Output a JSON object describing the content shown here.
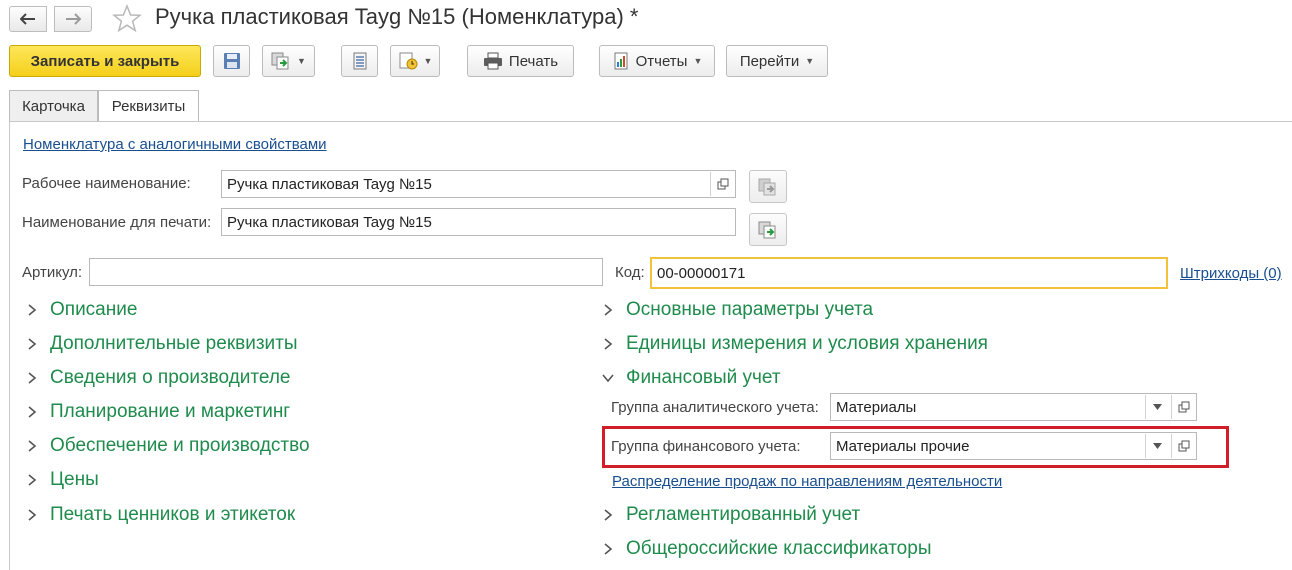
{
  "header": {
    "title": "Ручка пластиковая Tayg №15 (Номенклатура) *"
  },
  "toolbar": {
    "save_close": "Записать и закрыть",
    "print": "Печать",
    "reports": "Отчеты",
    "goto": "Перейти"
  },
  "tabs": [
    {
      "label": "Карточка"
    },
    {
      "label": "Реквизиты"
    }
  ],
  "form": {
    "similar_link": "Номенклатура с аналогичными свойствами",
    "work_name_label": "Рабочее наименование:",
    "work_name_value": "Ручка пластиковая Tayg №15",
    "print_name_label": "Наименование для печати:",
    "print_name_value": "Ручка пластиковая Tayg №15",
    "article_label": "Артикул:",
    "article_value": "",
    "code_label": "Код:",
    "code_value": "00-00000171",
    "barcodes_link": "Штрихкоды (0)"
  },
  "left_groups": [
    {
      "label": "Описание"
    },
    {
      "label": "Дополнительные реквизиты"
    },
    {
      "label": "Сведения о производителе"
    },
    {
      "label": "Планирование и маркетинг"
    },
    {
      "label": "Обеспечение и производство"
    },
    {
      "label": "Цены"
    },
    {
      "label": "Печать ценников и этикеток"
    }
  ],
  "right_groups": {
    "main_params": "Основные параметры учета",
    "units": "Единицы измерения и условия хранения",
    "financial": "Финансовый учет",
    "regulated": "Регламентированный учет",
    "classifiers": "Общероссийские классификаторы"
  },
  "financial": {
    "analytic_label": "Группа аналитического учета:",
    "analytic_value": "Материалы",
    "fin_label": "Группа финансового учета:",
    "fin_value": "Материалы прочие",
    "sales_link": "Распределение продаж по направлениям деятельности"
  },
  "colors": {
    "accent_yellow": "#f5cf1b",
    "group_green": "#1f8b4c",
    "link_blue": "#1a4f8f",
    "highlight_red": "#d11f2a"
  }
}
